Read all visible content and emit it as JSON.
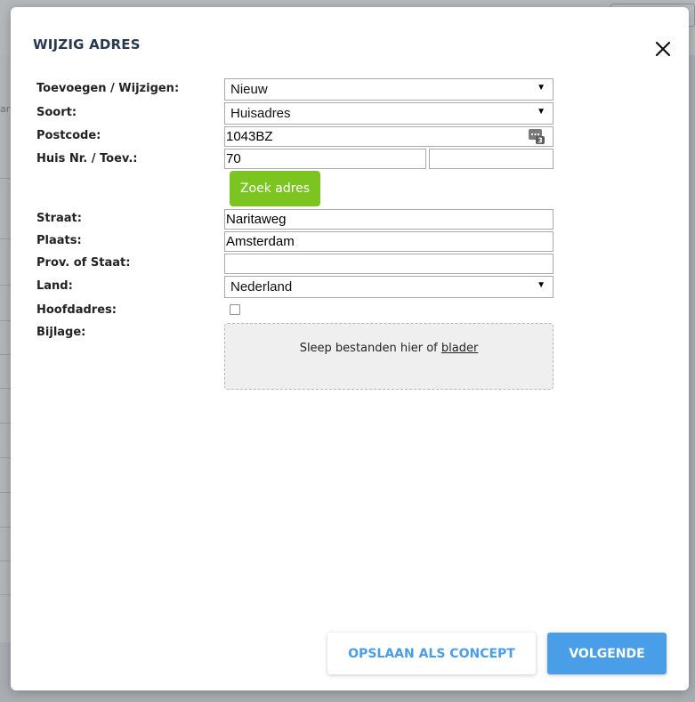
{
  "background": {
    "fragments": [
      "ar"
    ]
  },
  "modal": {
    "title": "WIJZIG ADRES",
    "close_icon": "close-icon"
  },
  "form": {
    "toevoegen_label": "Toevoegen / Wijzigen:",
    "toevoegen_value": "Nieuw",
    "soort_label": "Soort:",
    "soort_value": "Huisadres",
    "postcode_label": "Postcode:",
    "postcode_value": "1043BZ",
    "postcode_icon": "password-manager-icon",
    "huisnr_label": "Huis Nr. / Toev.:",
    "huisnr_value": "70",
    "toev_value": "",
    "zoek_button": "Zoek adres",
    "straat_label": "Straat:",
    "straat_value": "Naritaweg",
    "plaats_label": "Plaats:",
    "plaats_value": "Amsterdam",
    "prov_label": "Prov. of Staat:",
    "prov_value": "",
    "land_label": "Land:",
    "land_value": "Nederland",
    "hoofdadres_label": "Hoofdadres:",
    "hoofdadres_checked": false,
    "bijlage_label": "Bijlage:",
    "dropzone_text": "Sleep bestanden hier of ",
    "dropzone_link": "blader"
  },
  "footer": {
    "concept_button": "OPSLAAN ALS CONCEPT",
    "next_button": "VOLGENDE"
  },
  "colors": {
    "accent_blue": "#4a9ee8",
    "green": "#7cc521",
    "title": "#273a4f"
  }
}
